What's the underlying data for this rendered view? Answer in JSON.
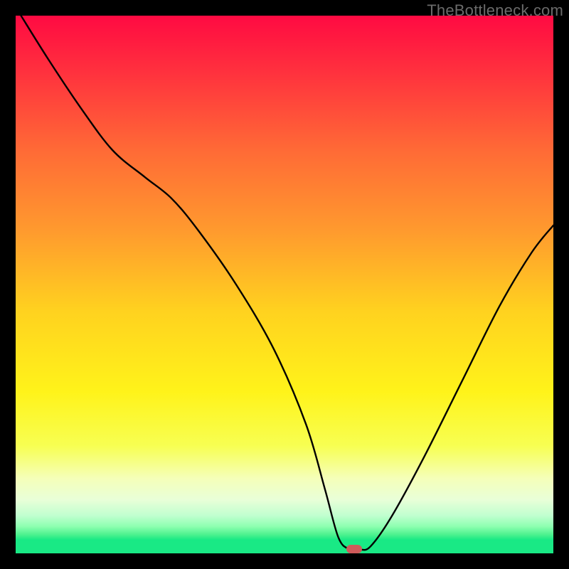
{
  "watermark": "TheBottleneck.com",
  "chart_data": {
    "type": "line",
    "title": "",
    "xlabel": "",
    "ylabel": "",
    "xlim": [
      0,
      100
    ],
    "ylim": [
      0,
      100
    ],
    "gradient_stops": [
      {
        "pos": 0.0,
        "color": "#ff0a42"
      },
      {
        "pos": 0.1,
        "color": "#ff2f3e"
      },
      {
        "pos": 0.25,
        "color": "#ff6a36"
      },
      {
        "pos": 0.4,
        "color": "#ff9a2e"
      },
      {
        "pos": 0.55,
        "color": "#ffd21f"
      },
      {
        "pos": 0.7,
        "color": "#fff31a"
      },
      {
        "pos": 0.8,
        "color": "#f7ff52"
      },
      {
        "pos": 0.86,
        "color": "#f5ffb8"
      },
      {
        "pos": 0.9,
        "color": "#e9ffd8"
      },
      {
        "pos": 0.93,
        "color": "#c0ffcf"
      },
      {
        "pos": 0.95,
        "color": "#8dffb0"
      },
      {
        "pos": 0.965,
        "color": "#4ef28f"
      },
      {
        "pos": 0.975,
        "color": "#19e985"
      },
      {
        "pos": 1.0,
        "color": "#19e985"
      }
    ],
    "series": [
      {
        "name": "bottleneck-curve",
        "x": [
          1,
          6,
          12,
          18,
          24,
          29,
          34,
          41,
          48,
          54,
          57.5,
          60,
          62,
          64,
          66,
          70,
          76,
          83,
          90,
          96,
          100
        ],
        "y": [
          100,
          92,
          83,
          75,
          70,
          66,
          60,
          50,
          38,
          24,
          12,
          3,
          0.8,
          0.7,
          1.3,
          7,
          18,
          32,
          46,
          56,
          61
        ]
      }
    ],
    "bottleneck_marker": {
      "x": 63,
      "y": 0.8
    },
    "bottom_band": {
      "from_y": 0,
      "to_y": 2.5,
      "color": "#19e985"
    }
  }
}
